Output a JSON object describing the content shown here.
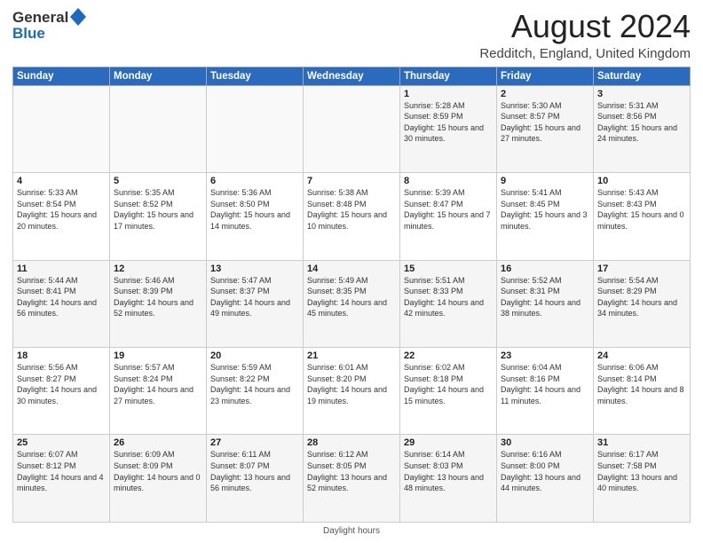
{
  "header": {
    "logo": {
      "line1": "General",
      "line2": "Blue"
    },
    "title": "August 2024",
    "subtitle": "Redditch, England, United Kingdom"
  },
  "days_of_week": [
    "Sunday",
    "Monday",
    "Tuesday",
    "Wednesday",
    "Thursday",
    "Friday",
    "Saturday"
  ],
  "weeks": [
    [
      {
        "num": "",
        "sunrise": "",
        "sunset": "",
        "daylight": ""
      },
      {
        "num": "",
        "sunrise": "",
        "sunset": "",
        "daylight": ""
      },
      {
        "num": "",
        "sunrise": "",
        "sunset": "",
        "daylight": ""
      },
      {
        "num": "",
        "sunrise": "",
        "sunset": "",
        "daylight": ""
      },
      {
        "num": "1",
        "sunrise": "5:28 AM",
        "sunset": "8:59 PM",
        "daylight": "15 hours and 30 minutes."
      },
      {
        "num": "2",
        "sunrise": "5:30 AM",
        "sunset": "8:57 PM",
        "daylight": "15 hours and 27 minutes."
      },
      {
        "num": "3",
        "sunrise": "5:31 AM",
        "sunset": "8:56 PM",
        "daylight": "15 hours and 24 minutes."
      }
    ],
    [
      {
        "num": "4",
        "sunrise": "5:33 AM",
        "sunset": "8:54 PM",
        "daylight": "15 hours and 20 minutes."
      },
      {
        "num": "5",
        "sunrise": "5:35 AM",
        "sunset": "8:52 PM",
        "daylight": "15 hours and 17 minutes."
      },
      {
        "num": "6",
        "sunrise": "5:36 AM",
        "sunset": "8:50 PM",
        "daylight": "15 hours and 14 minutes."
      },
      {
        "num": "7",
        "sunrise": "5:38 AM",
        "sunset": "8:48 PM",
        "daylight": "15 hours and 10 minutes."
      },
      {
        "num": "8",
        "sunrise": "5:39 AM",
        "sunset": "8:47 PM",
        "daylight": "15 hours and 7 minutes."
      },
      {
        "num": "9",
        "sunrise": "5:41 AM",
        "sunset": "8:45 PM",
        "daylight": "15 hours and 3 minutes."
      },
      {
        "num": "10",
        "sunrise": "5:43 AM",
        "sunset": "8:43 PM",
        "daylight": "15 hours and 0 minutes."
      }
    ],
    [
      {
        "num": "11",
        "sunrise": "5:44 AM",
        "sunset": "8:41 PM",
        "daylight": "14 hours and 56 minutes."
      },
      {
        "num": "12",
        "sunrise": "5:46 AM",
        "sunset": "8:39 PM",
        "daylight": "14 hours and 52 minutes."
      },
      {
        "num": "13",
        "sunrise": "5:47 AM",
        "sunset": "8:37 PM",
        "daylight": "14 hours and 49 minutes."
      },
      {
        "num": "14",
        "sunrise": "5:49 AM",
        "sunset": "8:35 PM",
        "daylight": "14 hours and 45 minutes."
      },
      {
        "num": "15",
        "sunrise": "5:51 AM",
        "sunset": "8:33 PM",
        "daylight": "14 hours and 42 minutes."
      },
      {
        "num": "16",
        "sunrise": "5:52 AM",
        "sunset": "8:31 PM",
        "daylight": "14 hours and 38 minutes."
      },
      {
        "num": "17",
        "sunrise": "5:54 AM",
        "sunset": "8:29 PM",
        "daylight": "14 hours and 34 minutes."
      }
    ],
    [
      {
        "num": "18",
        "sunrise": "5:56 AM",
        "sunset": "8:27 PM",
        "daylight": "14 hours and 30 minutes."
      },
      {
        "num": "19",
        "sunrise": "5:57 AM",
        "sunset": "8:24 PM",
        "daylight": "14 hours and 27 minutes."
      },
      {
        "num": "20",
        "sunrise": "5:59 AM",
        "sunset": "8:22 PM",
        "daylight": "14 hours and 23 minutes."
      },
      {
        "num": "21",
        "sunrise": "6:01 AM",
        "sunset": "8:20 PM",
        "daylight": "14 hours and 19 minutes."
      },
      {
        "num": "22",
        "sunrise": "6:02 AM",
        "sunset": "8:18 PM",
        "daylight": "14 hours and 15 minutes."
      },
      {
        "num": "23",
        "sunrise": "6:04 AM",
        "sunset": "8:16 PM",
        "daylight": "14 hours and 11 minutes."
      },
      {
        "num": "24",
        "sunrise": "6:06 AM",
        "sunset": "8:14 PM",
        "daylight": "14 hours and 8 minutes."
      }
    ],
    [
      {
        "num": "25",
        "sunrise": "6:07 AM",
        "sunset": "8:12 PM",
        "daylight": "14 hours and 4 minutes."
      },
      {
        "num": "26",
        "sunrise": "6:09 AM",
        "sunset": "8:09 PM",
        "daylight": "14 hours and 0 minutes."
      },
      {
        "num": "27",
        "sunrise": "6:11 AM",
        "sunset": "8:07 PM",
        "daylight": "13 hours and 56 minutes."
      },
      {
        "num": "28",
        "sunrise": "6:12 AM",
        "sunset": "8:05 PM",
        "daylight": "13 hours and 52 minutes."
      },
      {
        "num": "29",
        "sunrise": "6:14 AM",
        "sunset": "8:03 PM",
        "daylight": "13 hours and 48 minutes."
      },
      {
        "num": "30",
        "sunrise": "6:16 AM",
        "sunset": "8:00 PM",
        "daylight": "13 hours and 44 minutes."
      },
      {
        "num": "31",
        "sunrise": "6:17 AM",
        "sunset": "7:58 PM",
        "daylight": "13 hours and 40 minutes."
      }
    ]
  ],
  "footer": "Daylight hours"
}
